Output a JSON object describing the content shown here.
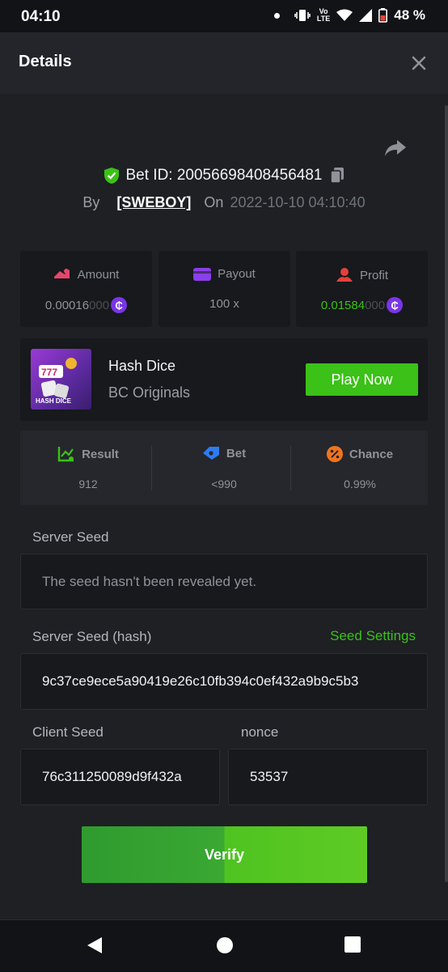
{
  "status_bar": {
    "time": "04:10",
    "network_top": "Vo",
    "network_bottom": "LTE",
    "battery": "48 %"
  },
  "header": {
    "title": "Details"
  },
  "bet": {
    "id_label": "Bet ID: 20056698408456481",
    "by_label": "By",
    "user": "[SWEBOY]",
    "on_label": "On",
    "date": "2022-10-10 04:10:40"
  },
  "stats": {
    "amount": {
      "label": "Amount",
      "value": "0.00016",
      "value_dim": "000"
    },
    "payout": {
      "label": "Payout",
      "value": "100 x"
    },
    "profit": {
      "label": "Profit",
      "value": "0.01584",
      "value_dim": "000"
    }
  },
  "game": {
    "thumb_label": "HASH DICE",
    "name": "Hash Dice",
    "provider": "BC Originals",
    "play_label": "Play Now"
  },
  "result": {
    "result": {
      "label": "Result",
      "value": "912"
    },
    "bet": {
      "label": "Bet",
      "value": "<990"
    },
    "chance": {
      "label": "Chance",
      "value": "0.99%"
    }
  },
  "server_seed": {
    "label": "Server Seed",
    "placeholder": "The seed hasn't been revealed yet."
  },
  "server_seed_hash": {
    "label": "Server Seed (hash)",
    "settings_label": "Seed Settings",
    "value": "9c37ce9ece5a90419e26c10fb394c0ef432a9b9c5b3"
  },
  "client_seed": {
    "label": "Client Seed",
    "value": "76c311250089d9f432a"
  },
  "nonce": {
    "label": "nonce",
    "value": "53537"
  },
  "verify_label": "Verify",
  "colors": {
    "accent_green": "#3bc117",
    "coin_purple": "#7a35e6",
    "background": "#1e2024"
  }
}
